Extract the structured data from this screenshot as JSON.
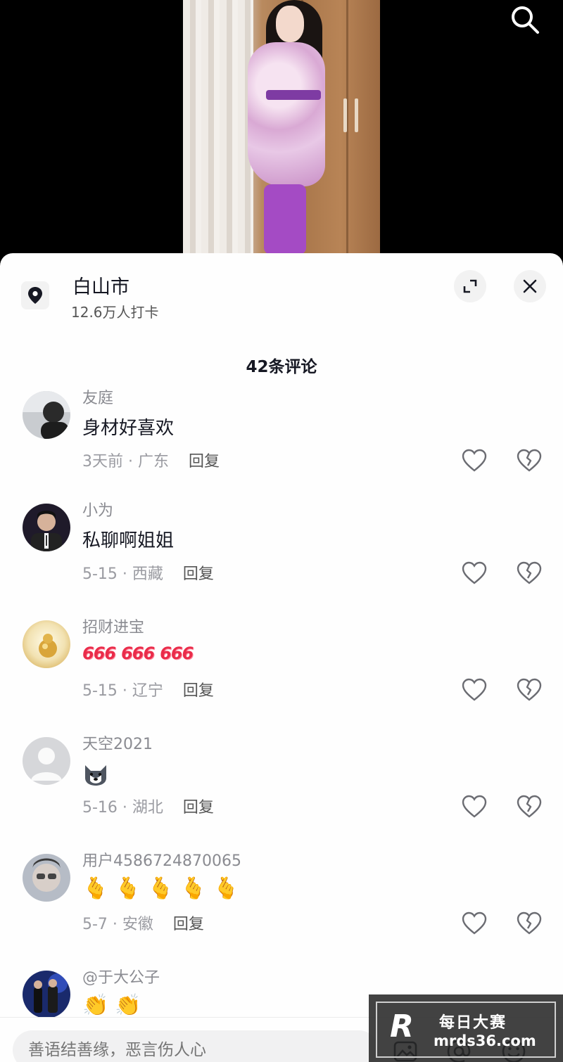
{
  "video": {
    "search_icon": "search-icon"
  },
  "location": {
    "title": "白山市",
    "checkins": "12.6万人打卡",
    "pin_icon": "location-pin-icon"
  },
  "comments_header": {
    "count_label": "42条评论"
  },
  "comments": [
    {
      "name": "友庭",
      "text": "身材好喜欢",
      "meta": "3天前 · 广东",
      "reply": "回复"
    },
    {
      "name": "小为",
      "text": "私聊啊姐姐",
      "meta": "5-15 · 西藏",
      "reply": "回复"
    },
    {
      "name": "招财进宝",
      "text": "666 666 666",
      "meta": "5-15 · 辽宁",
      "reply": "回复"
    },
    {
      "name": "天空2021",
      "text": "",
      "meta": "5-16 · 湖北",
      "reply": "回复"
    },
    {
      "name": "用户4586724870065",
      "text": "",
      "meta": "5-7 · 安徽",
      "reply": "回复"
    },
    {
      "name": "@于大公子",
      "text": "",
      "meta": "",
      "reply": ""
    }
  ],
  "emoji": {
    "e666": "666",
    "husky": "husky-emoji",
    "heart_hand": "🫰",
    "clap": "👏"
  },
  "input": {
    "placeholder": "善语结善缘，恶言伤人心"
  },
  "watermark": {
    "logo": "R",
    "name": "每日大赛",
    "url": "mrds36.com"
  },
  "colors": {
    "text_primary": "#161823",
    "text_secondary": "#8a8b91",
    "accent_666": "#ea2c4a",
    "sheet_bg": "#fefefe"
  }
}
